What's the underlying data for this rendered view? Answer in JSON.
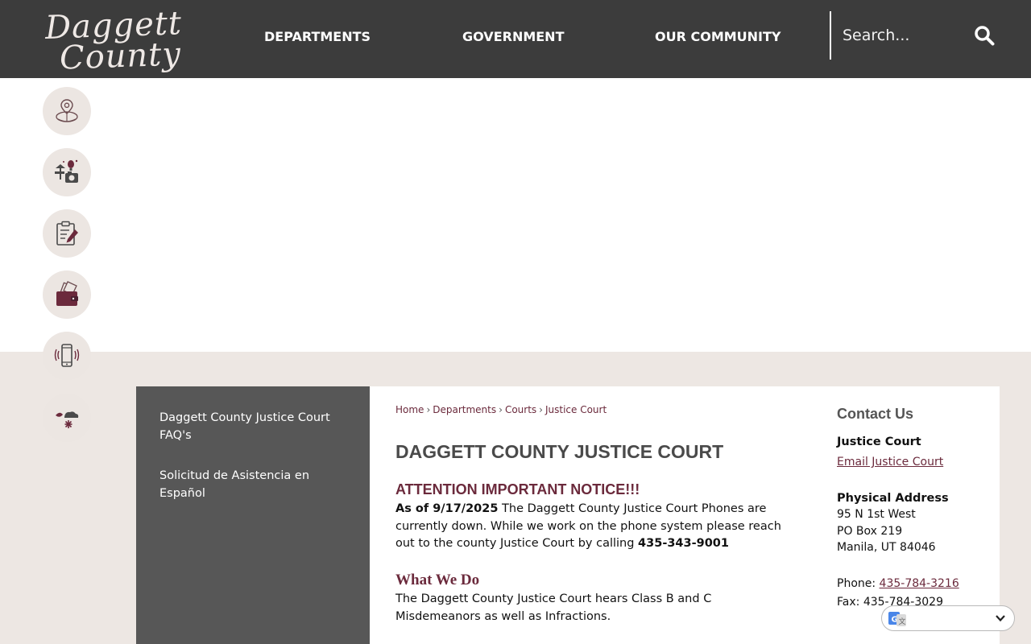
{
  "header": {
    "logo_line1": "Daggett",
    "logo_line2": "County",
    "nav": [
      {
        "label": "DEPARTMENTS"
      },
      {
        "label": "GOVERNMENT"
      },
      {
        "label": "OUR COMMUNITY"
      }
    ],
    "search_placeholder": "Search..."
  },
  "quick_links": [
    {
      "icon": "map-pin-globe-icon"
    },
    {
      "icon": "recreation-camera-icon"
    },
    {
      "icon": "clipboard-pencil-icon"
    },
    {
      "icon": "wallet-icon"
    },
    {
      "icon": "mobile-phone-icon"
    },
    {
      "icon": "weather-icon"
    }
  ],
  "sidenav": {
    "items": [
      {
        "label": "Daggett County Justice Court FAQ's"
      },
      {
        "label": "Solicitud de Asistencia en Español"
      }
    ]
  },
  "breadcrumb": {
    "home": "Home",
    "departments": "Departments",
    "courts": "Courts",
    "current": "Justice Court",
    "sep": "›"
  },
  "main": {
    "title": "DAGGETT COUNTY JUSTICE COURT",
    "notice_heading": "ATTENTION IMPORTANT NOTICE!!!",
    "notice_date": "As of 9/17/2025",
    "notice_text": " The Daggett County Justice Court Phones are currently down. While we work on the phone system please reach out to the county Justice Court by calling ",
    "notice_phone": "435-343-9001",
    "what_heading": "What We Do",
    "what_text": "The Daggett County Justice Court hears Class B and C Misdemeanors as well as Infractions."
  },
  "contact": {
    "heading": "Contact Us",
    "name": "Justice Court",
    "email_link": "Email Justice Court",
    "address_heading": "Physical Address",
    "address_line1": "95 N 1st West",
    "address_line2": "PO Box 219",
    "address_line3": "Manila, UT 84046",
    "phone_label": "Phone: ",
    "phone": "435-784-3216",
    "fax_label": "Fax: ",
    "fax": "435-784-3029"
  },
  "colors": {
    "header_bg": "#3c3c3c",
    "accent": "#6b2a3c",
    "beige": "#ede7e3",
    "sidenav_bg": "#575757"
  }
}
